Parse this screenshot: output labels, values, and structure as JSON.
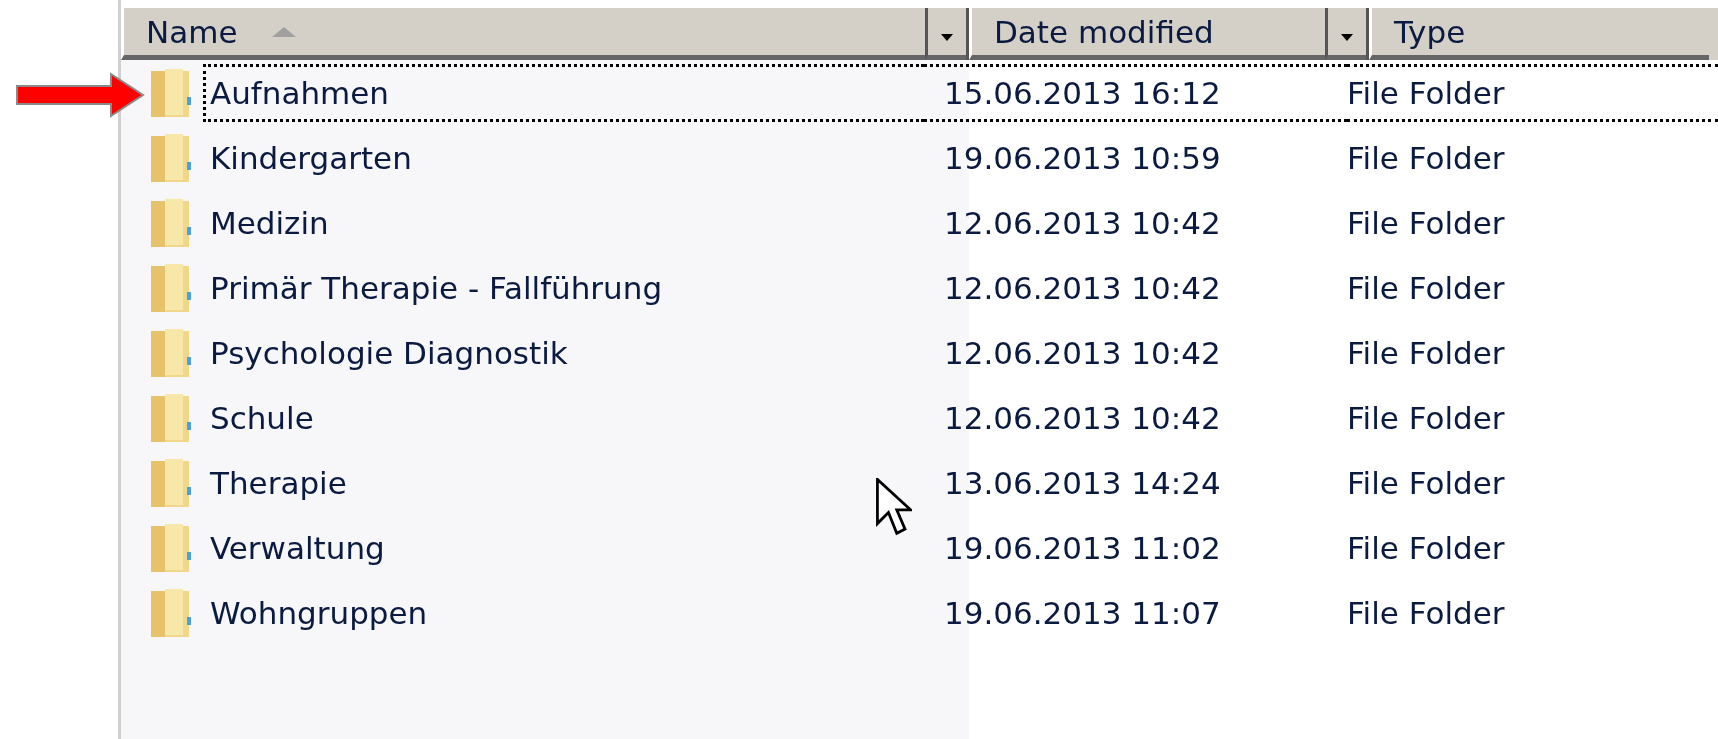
{
  "columns": [
    {
      "label": "Name",
      "sorted": true,
      "dropdown": true
    },
    {
      "label": "Date modified",
      "sorted": false,
      "dropdown": true
    },
    {
      "label": "Type",
      "sorted": false,
      "dropdown": false
    }
  ],
  "rows": [
    {
      "name": "Aufnahmen",
      "date": "15.06.2013 16:12",
      "type": "File Folder",
      "focused": true,
      "pointed": true
    },
    {
      "name": "Kindergarten",
      "date": "19.06.2013 10:59",
      "type": "File Folder",
      "focused": false,
      "pointed": false
    },
    {
      "name": "Medizin",
      "date": "12.06.2013 10:42",
      "type": "File Folder",
      "focused": false,
      "pointed": false
    },
    {
      "name": "Primär Therapie - Fallführung",
      "date": "12.06.2013 10:42",
      "type": "File Folder",
      "focused": false,
      "pointed": false
    },
    {
      "name": "Psychologie Diagnostik",
      "date": "12.06.2013 10:42",
      "type": "File Folder",
      "focused": false,
      "pointed": false
    },
    {
      "name": "Schule",
      "date": "12.06.2013 10:42",
      "type": "File Folder",
      "focused": false,
      "pointed": false
    },
    {
      "name": "Therapie",
      "date": "13.06.2013 14:24",
      "type": "File Folder",
      "focused": false,
      "pointed": false
    },
    {
      "name": "Verwaltung",
      "date": "19.06.2013 11:02",
      "type": "File Folder",
      "focused": false,
      "pointed": false
    },
    {
      "name": "Wohngruppen",
      "date": "19.06.2013 11:07",
      "type": "File Folder",
      "focused": false,
      "pointed": false
    }
  ]
}
